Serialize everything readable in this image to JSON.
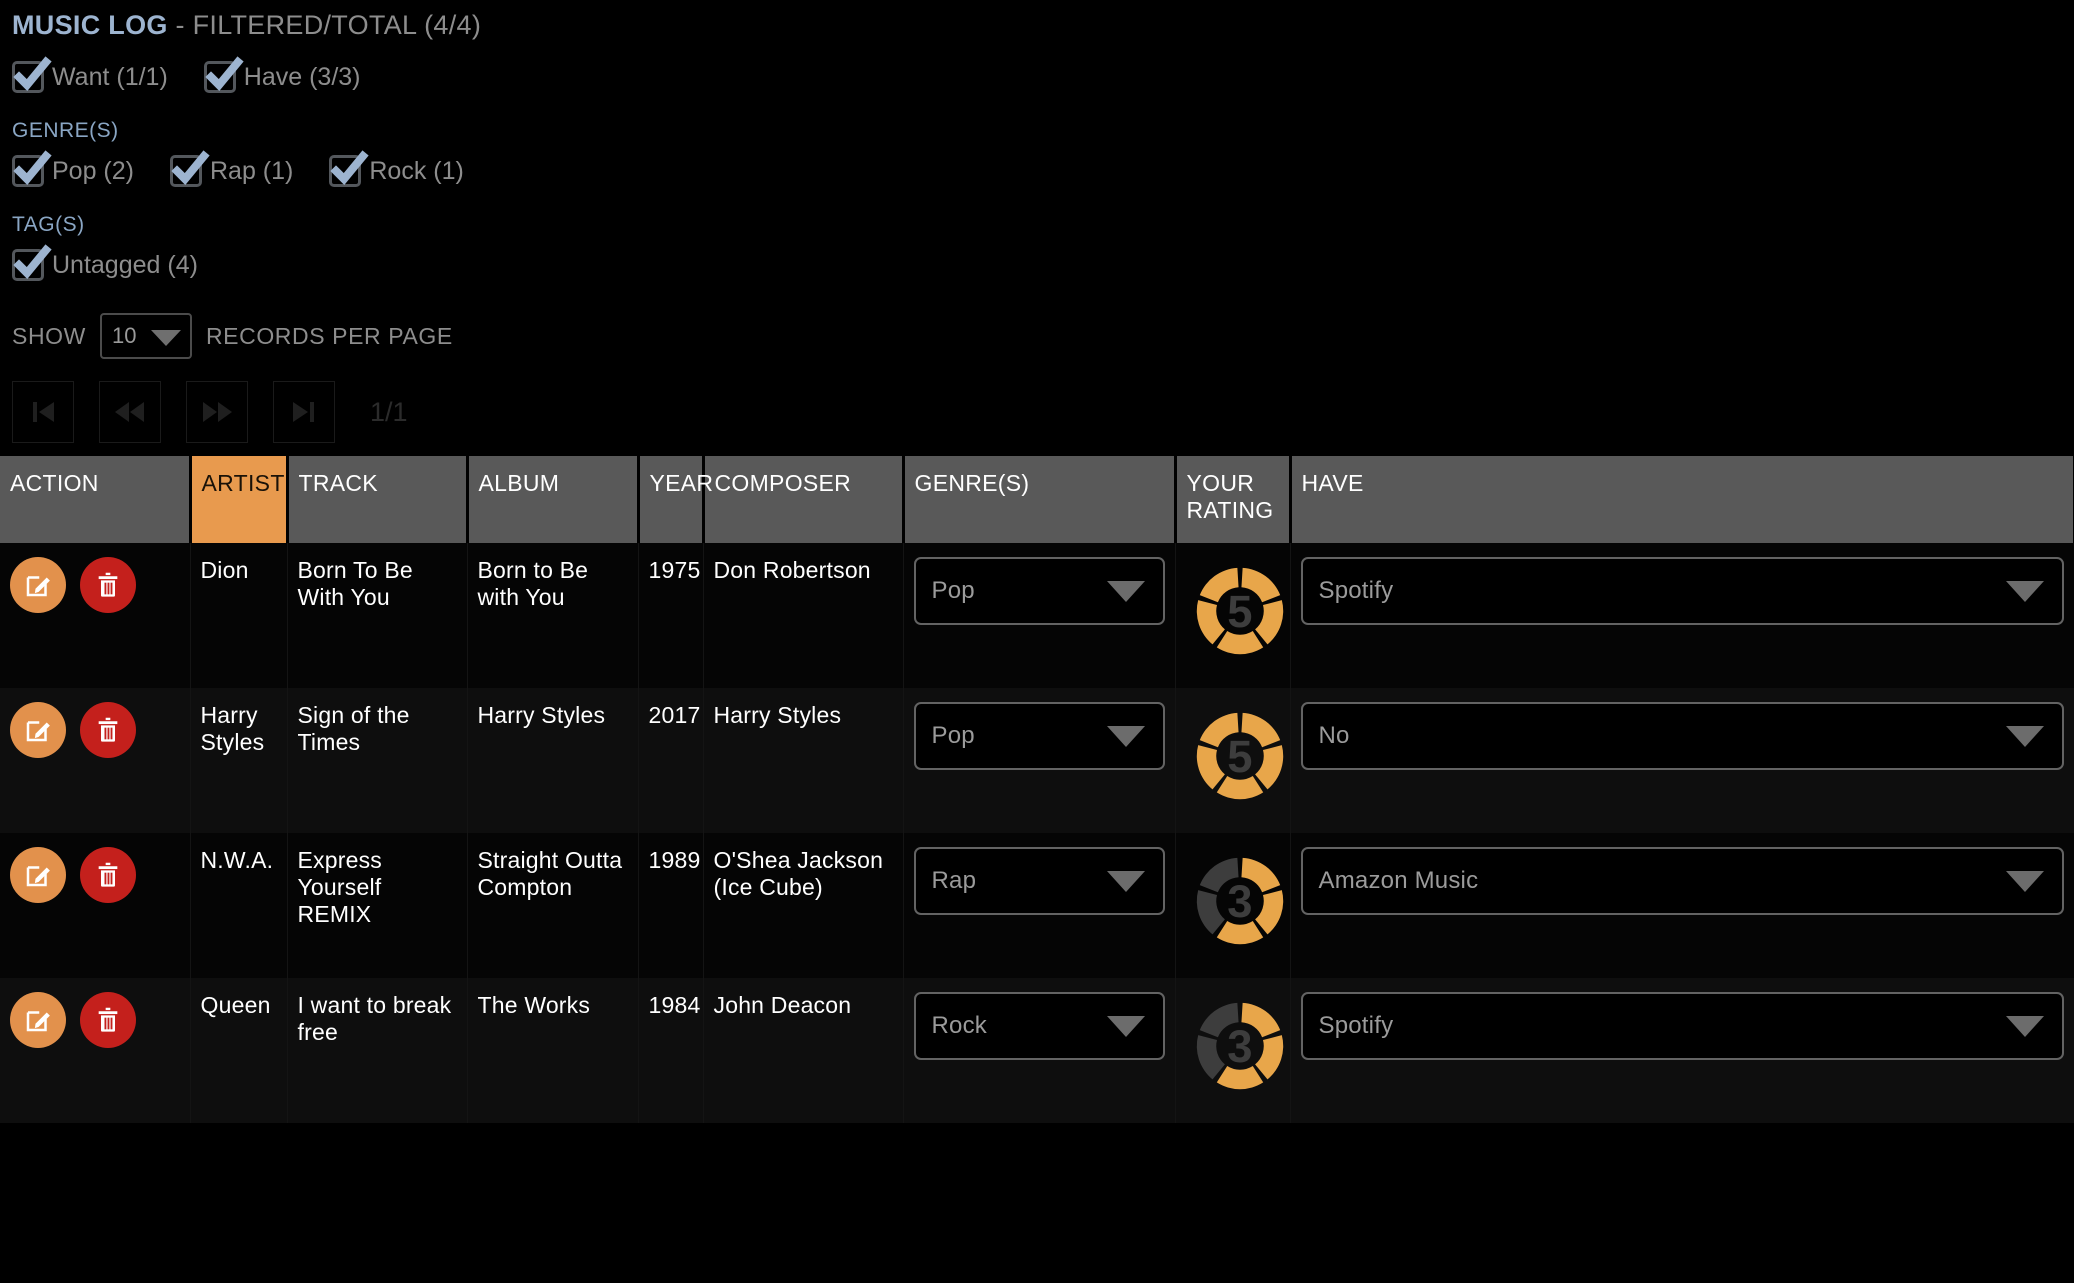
{
  "header": {
    "title_strong": "MUSIC LOG",
    "title_muted": " - FILTERED/TOTAL (4/4)"
  },
  "status_filters": [
    {
      "label": "Want (1/1)",
      "checked": true
    },
    {
      "label": "Have (3/3)",
      "checked": true
    }
  ],
  "genre_section": {
    "label": "GENRE(S)",
    "items": [
      {
        "label": "Pop (2)",
        "checked": true
      },
      {
        "label": "Rap (1)",
        "checked": true
      },
      {
        "label": "Rock (1)",
        "checked": true
      }
    ]
  },
  "tag_section": {
    "label": "TAG(S)",
    "items": [
      {
        "label": "Untagged (4)",
        "checked": true
      }
    ]
  },
  "records_bar": {
    "show_label": "SHOW",
    "page_size": "10",
    "after_label": "RECORDS PER PAGE"
  },
  "pager": {
    "first_icon": "skip-first-icon",
    "prev_icon": "rewind-icon",
    "next_icon": "fast-forward-icon",
    "last_icon": "skip-last-icon",
    "page_indicator": "1/1"
  },
  "table": {
    "columns": [
      {
        "label": "ACTION",
        "sorted": false
      },
      {
        "label": "ARTIST",
        "sorted": true
      },
      {
        "label": "TRACK",
        "sorted": false
      },
      {
        "label": "ALBUM",
        "sorted": false
      },
      {
        "label": "YEAR",
        "sorted": false
      },
      {
        "label": "COMPOSER",
        "sorted": false
      },
      {
        "label": "GENRE(S)",
        "sorted": false
      },
      {
        "label": "YOUR RATING",
        "sorted": false
      },
      {
        "label": "HAVE",
        "sorted": false
      }
    ],
    "rows": [
      {
        "artist": "Dion",
        "track": "Born To Be With You",
        "album": "Born to Be with You",
        "year": "1975",
        "composer": "Don Robertson",
        "genre": "Pop",
        "rating": 5,
        "have": "Spotify"
      },
      {
        "artist": "Harry Styles",
        "track": "Sign of the Times",
        "album": "Harry Styles",
        "year": "2017",
        "composer": "Harry Styles",
        "genre": "Pop",
        "rating": 5,
        "have": "No"
      },
      {
        "artist": "N.W.A.",
        "track": "Express Yourself REMIX",
        "album": "Straight Outta Compton",
        "year": "1989",
        "composer": "O'Shea Jackson (Ice Cube)",
        "genre": "Rap",
        "rating": 3,
        "have": "Amazon Music"
      },
      {
        "artist": "Queen",
        "track": "I want to break free",
        "album": "The Works",
        "year": "1984",
        "composer": "John Deacon",
        "genre": "Rock",
        "rating": 3,
        "have": "Spotify"
      }
    ]
  },
  "colors": {
    "accent_orange": "#e89a4e",
    "edit_orange": "#e2914c",
    "delete_red": "#c4201c",
    "rating_filled": "#e8a64a",
    "rating_empty": "#3d3d3d",
    "header_gray": "#595959",
    "checkbox_blue": "#9db4d0",
    "section_blue": "#8aa6c4"
  }
}
